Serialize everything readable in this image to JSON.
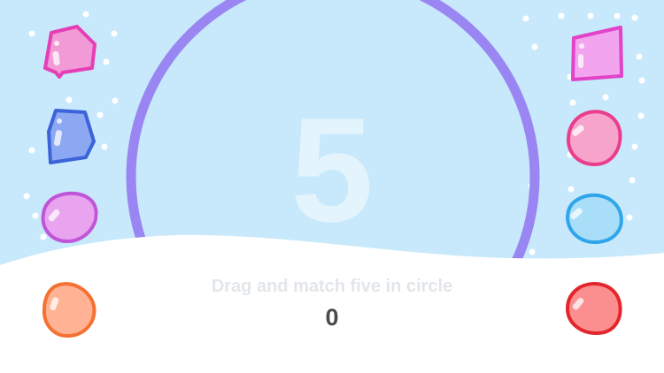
{
  "game": {
    "target_number": "5",
    "instruction": "Drag and match five in circle",
    "score": "0"
  },
  "colors": {
    "sky": "#c8e9fb",
    "ring": "#9a86f2",
    "snow": "#ffffff",
    "instruction_text": "#e2e6ea",
    "score_text": "#4a4a4a"
  },
  "pieces": {
    "left": [
      {
        "name": "pink-gem",
        "shape": "pentagon",
        "fill": "#f29ad6",
        "stroke": "#e43fb6"
      },
      {
        "name": "blue-gem",
        "shape": "pentagon",
        "fill": "#8ca8f2",
        "stroke": "#3d63d9"
      },
      {
        "name": "purple-blob",
        "shape": "blob",
        "fill": "#e9a4ef",
        "stroke": "#c155d8"
      },
      {
        "name": "orange-blob",
        "shape": "blob",
        "fill": "#ffb394",
        "stroke": "#f47133"
      }
    ],
    "right": [
      {
        "name": "magenta-gem",
        "shape": "trapezoid",
        "fill": "#f2a5ee",
        "stroke": "#e143c9"
      },
      {
        "name": "pink-blob",
        "shape": "blob",
        "fill": "#f6a4cb",
        "stroke": "#ea3d8e"
      },
      {
        "name": "cyan-blob",
        "shape": "blob",
        "fill": "#a9def8",
        "stroke": "#2fa5ea"
      },
      {
        "name": "red-blob",
        "shape": "blob",
        "fill": "#fb8e8e",
        "stroke": "#e2262c"
      }
    ]
  }
}
